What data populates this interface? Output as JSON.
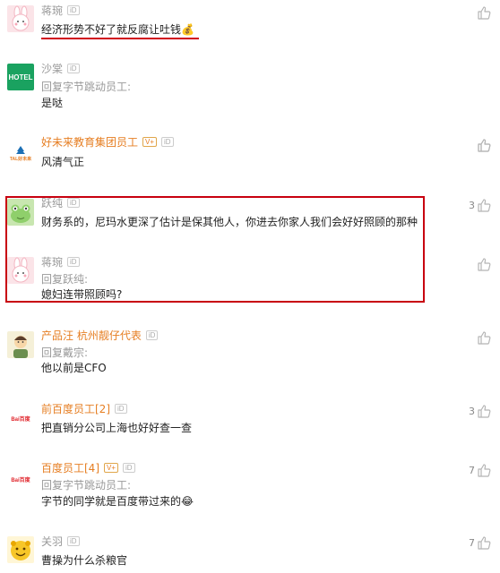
{
  "badges": {
    "id": "iD",
    "v": "V+"
  },
  "comments": [
    {
      "user": "蒋琬",
      "text": "经济形势不好了就反腐让吐钱",
      "emoji": "💰",
      "likes": ""
    },
    {
      "user": "沙棠",
      "avatar_text": "HOTEL",
      "reply": "回复字节跳动员工:",
      "text": "是哒",
      "likes": ""
    },
    {
      "user": "好未来教育集团员工",
      "avatar_text": "TAL好未来",
      "text": "风清气正",
      "likes": ""
    },
    {
      "user": "跃纯",
      "text": "财务系的，尼玛水更深了估计是保其他人，你进去你家人我们会好好照顾的那种",
      "likes": "3"
    },
    {
      "user": "蒋琬",
      "reply": "回复跃纯:",
      "text": "媳妇连带照顾吗?",
      "likes": ""
    },
    {
      "user": "产品汪 杭州靓仔代表",
      "reply": "回复戴宗:",
      "text": "他以前是CFO",
      "likes": ""
    },
    {
      "user": "前百度员工[2]",
      "avatar_text": "Bai百度",
      "text": "把直销分公司上海也好好查一查",
      "likes": "3"
    },
    {
      "user": "百度员工[4]",
      "avatar_text": "Bai百度",
      "reply": "回复字节跳动员工:",
      "text": "字节的同学就是百度带过来的",
      "emoji": "😂",
      "likes": "7"
    },
    {
      "user": "关羽",
      "text": "曹操为什么杀粮官",
      "likes": "7"
    }
  ]
}
